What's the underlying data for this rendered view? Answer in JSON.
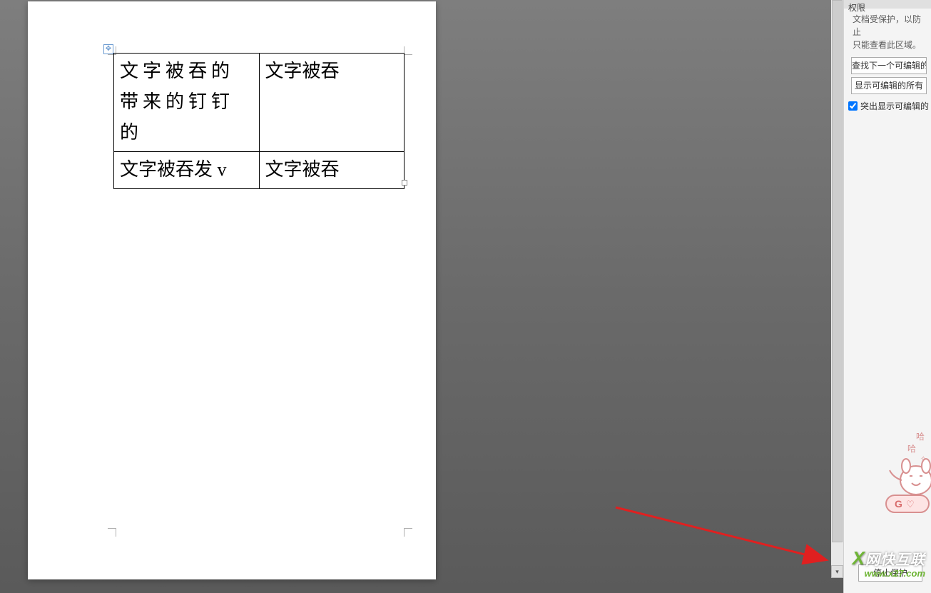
{
  "document": {
    "table": {
      "rows": [
        {
          "cell1": "文字被吞的带来的钉钉的",
          "cell2": "文字被吞"
        },
        {
          "cell1": "文字被吞发 v",
          "cell2": "文字被吞"
        }
      ]
    }
  },
  "panel": {
    "title": "权限",
    "description_line1": "文档受保护，以防止",
    "description_line2": "只能查看此区域。",
    "find_next_button": "查找下一个可编辑的",
    "show_all_button": "显示可编辑的所有",
    "highlight_checkbox_label": "突出显示可编辑的",
    "highlight_checked": true,
    "stop_protect_button": "停止保护"
  },
  "watermark": {
    "brand": "网快互联",
    "url": "www.x27.com"
  },
  "mascot": {
    "text1": "哈",
    "text2": "哈",
    "badge": "G♡"
  },
  "icons": {
    "table_handle": "✥"
  }
}
